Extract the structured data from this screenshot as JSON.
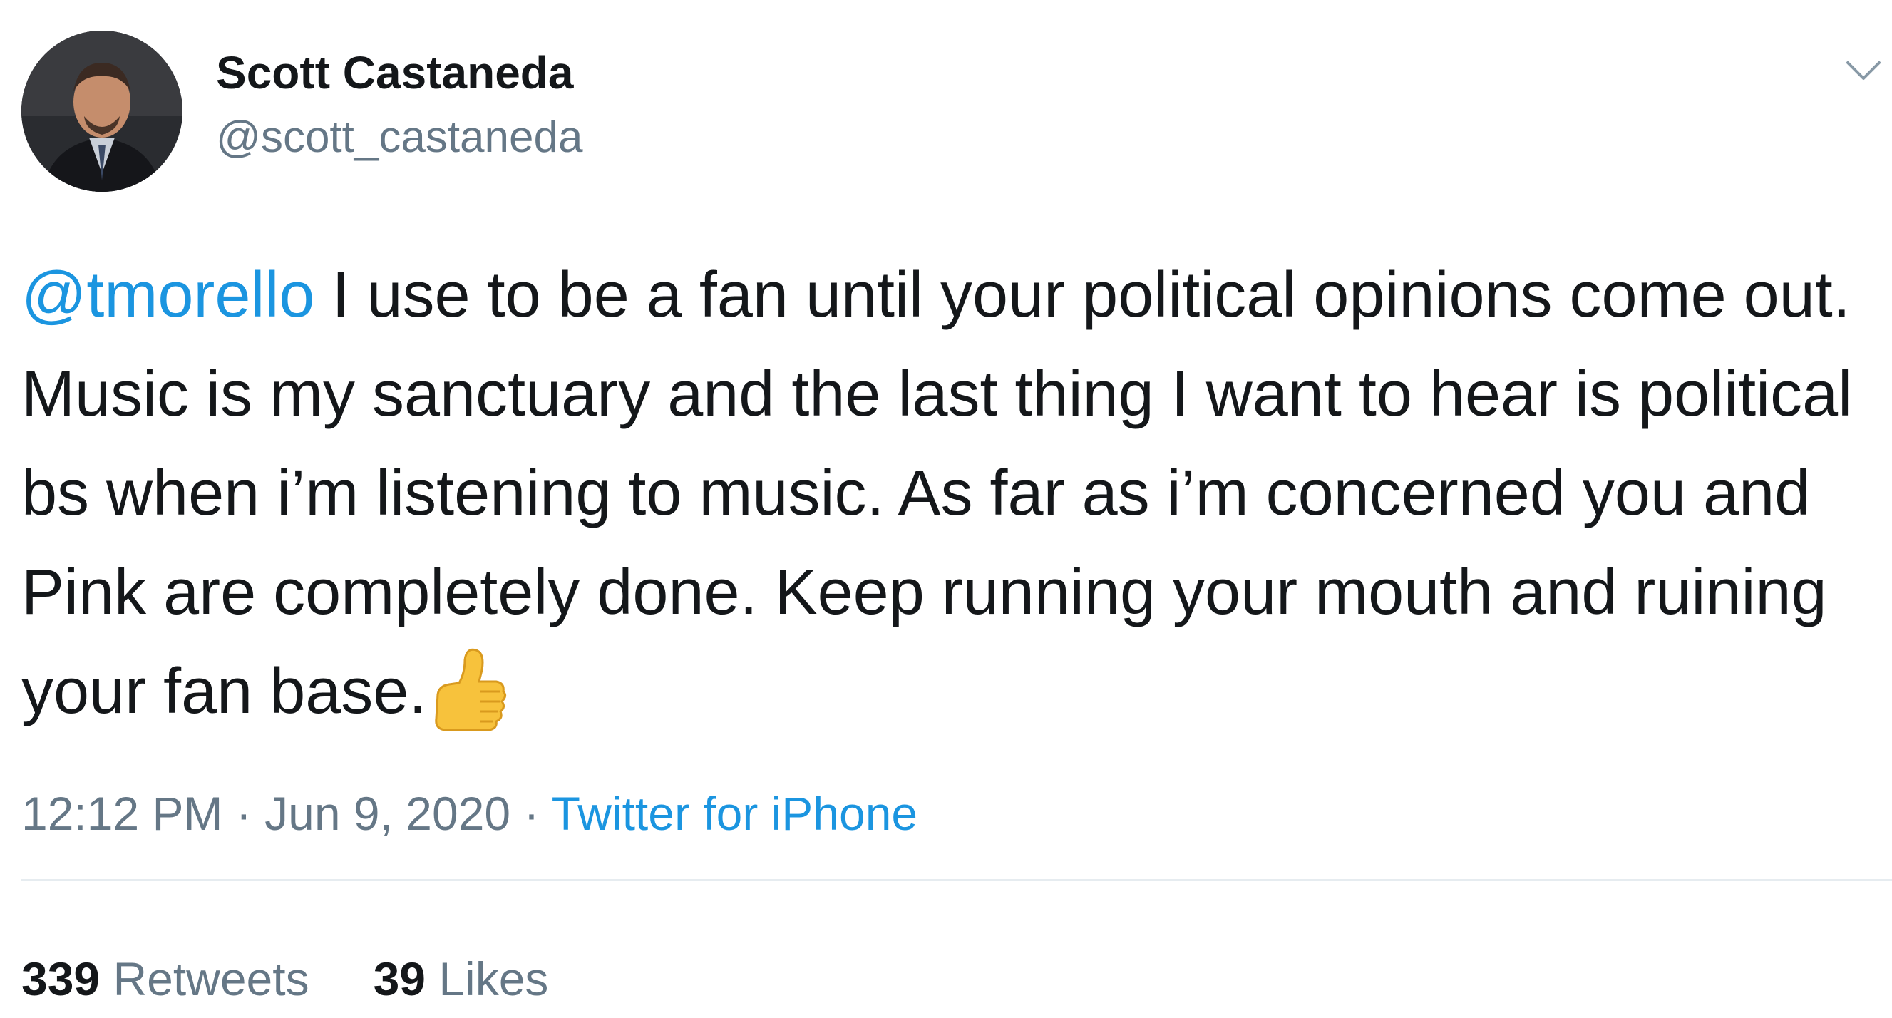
{
  "user": {
    "name": "Scott Castaneda",
    "handle": "@scott_castaneda"
  },
  "tweet": {
    "mention": "@tmorello",
    "text": " I use to be a fan until your political opinions come out. Music is my sanctuary and the last thing I want to hear is political bs when i’m listening to music. As far as i’m concerned you and Pink are completely done. Keep running your mouth and ruining your fan base.",
    "emoji": "thumbs-up-icon"
  },
  "meta": {
    "time": "12:12 PM",
    "separator1": " · ",
    "date": "Jun 9, 2020",
    "separator2": " · ",
    "source": "Twitter for iPhone"
  },
  "stats": {
    "retweets_count": "339",
    "retweets_label": " Retweets",
    "likes_count": "39",
    "likes_label": " Likes"
  },
  "colors": {
    "link": "#1b95e0",
    "secondary": "#657786",
    "text": "#14171a",
    "divider": "#e6ecf0"
  }
}
